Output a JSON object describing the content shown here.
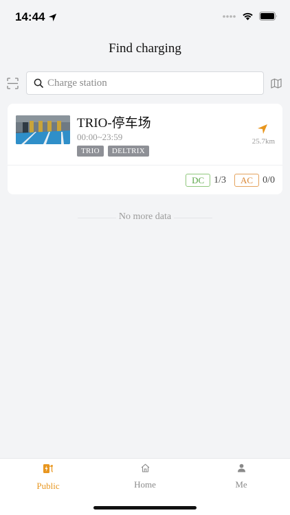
{
  "status_bar": {
    "time": "14:44"
  },
  "header": {
    "title": "Find charging"
  },
  "search": {
    "placeholder": "Charge station"
  },
  "stations": [
    {
      "name": "TRIO-停车场",
      "hours": "00:00~23:59",
      "tags": [
        "TRIO",
        "DELTRIX"
      ],
      "distance": "25.7km",
      "dc_label": "DC",
      "dc_count": "1/3",
      "ac_label": "AC",
      "ac_count": "0/0"
    }
  ],
  "list_end_text": "No more data",
  "tabbar": {
    "tabs": [
      {
        "label": "Public",
        "icon": "charging-station-icon",
        "active": true
      },
      {
        "label": "Home",
        "icon": "home-icon",
        "active": false
      },
      {
        "label": "Me",
        "icon": "person-icon",
        "active": false
      }
    ]
  },
  "colors": {
    "accent": "#e8961e",
    "dc": "#5aa547",
    "ac": "#d98634",
    "tag_bg": "#8e9096",
    "background": "#f3f4f6"
  }
}
